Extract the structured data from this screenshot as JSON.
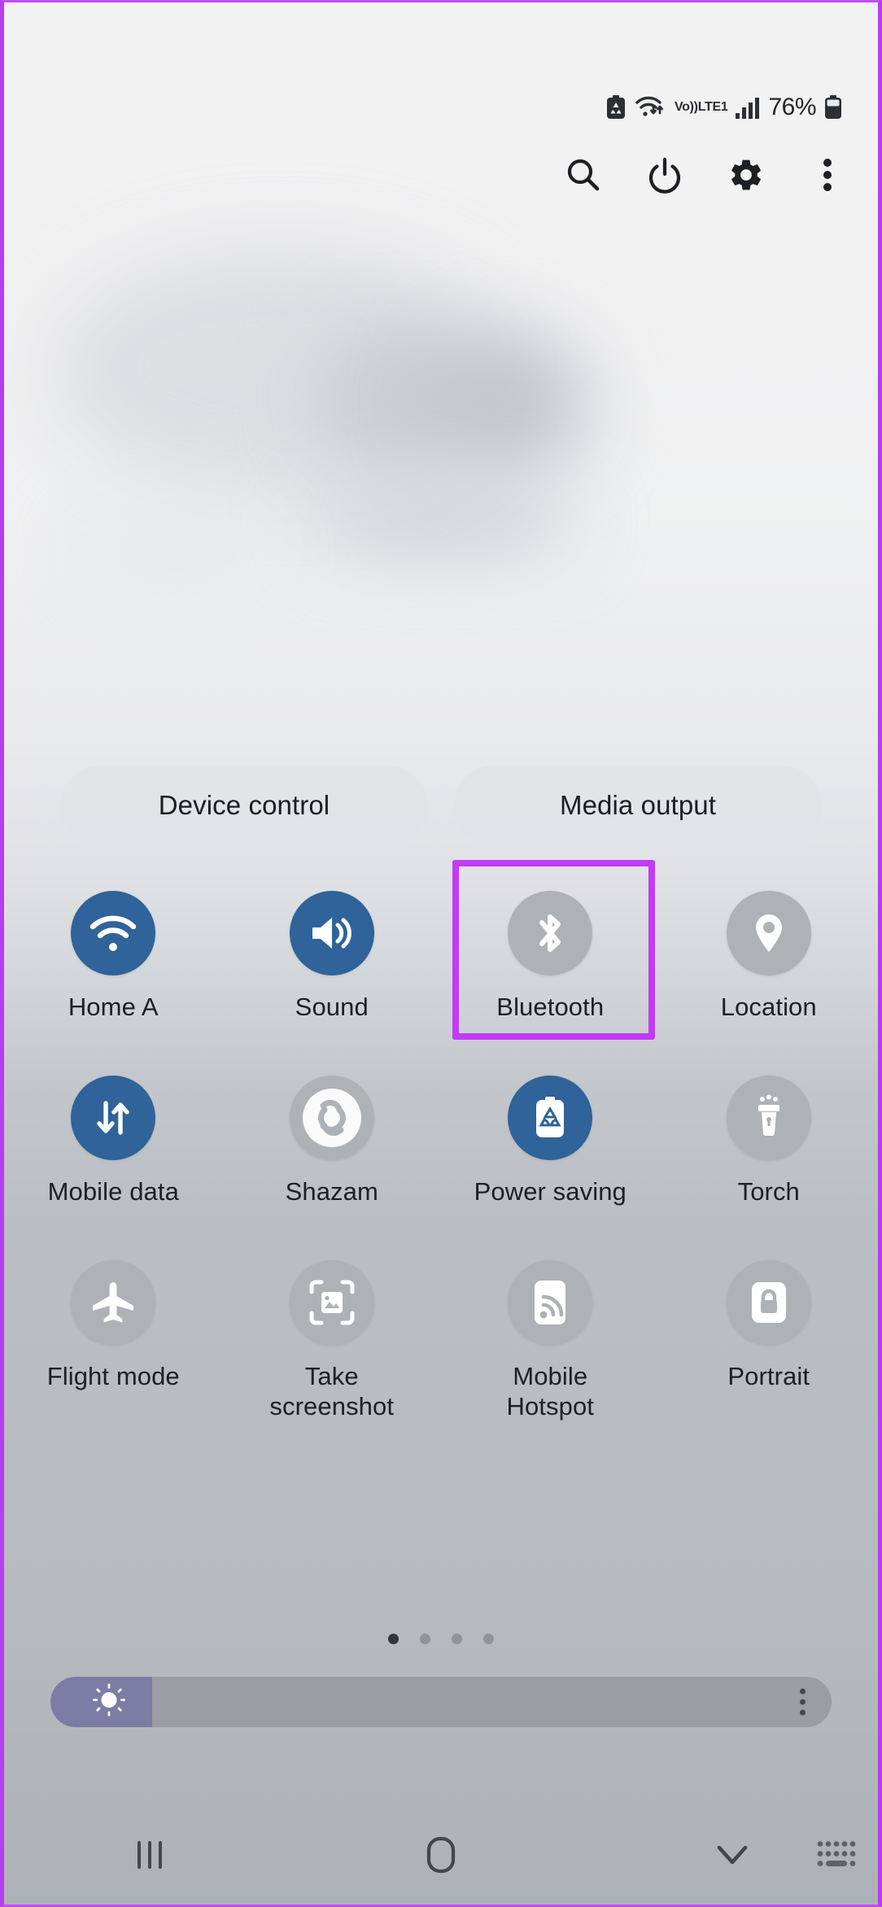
{
  "status_bar": {
    "battery_percent": "76%",
    "network_label": "Vo))",
    "network_sub": "LTE1",
    "icons": [
      "power-saving-battery-icon",
      "wifi-transfer-icon",
      "volte-icon",
      "signal-bars-icon",
      "battery-icon"
    ]
  },
  "header": {
    "actions": [
      {
        "name": "search-icon",
        "label": "Search"
      },
      {
        "name": "power-icon",
        "label": "Power"
      },
      {
        "name": "gear-icon",
        "label": "Settings"
      },
      {
        "name": "more-options-icon",
        "label": "More options"
      }
    ]
  },
  "shortcuts": {
    "device_control": "Device control",
    "media_output": "Media output"
  },
  "quick_settings": {
    "rows": [
      [
        {
          "label": "Home A",
          "icon": "wifi-icon",
          "state": "on"
        },
        {
          "label": "Sound",
          "icon": "volume-icon",
          "state": "on"
        },
        {
          "label": "Bluetooth",
          "icon": "bluetooth-icon",
          "state": "off",
          "highlighted": true
        },
        {
          "label": "Location",
          "icon": "location-pin-icon",
          "state": "off"
        }
      ],
      [
        {
          "label": "Mobile data",
          "icon": "mobile-data-icon",
          "state": "on"
        },
        {
          "label": "Shazam",
          "icon": "shazam-icon",
          "state": "off"
        },
        {
          "label": "Power saving",
          "icon": "power-saving-icon",
          "state": "on"
        },
        {
          "label": "Torch",
          "icon": "flashlight-icon",
          "state": "off"
        }
      ],
      [
        {
          "label": "Flight mode",
          "icon": "airplane-icon",
          "state": "off"
        },
        {
          "label": "Take screenshot",
          "icon": "screenshot-icon",
          "state": "off"
        },
        {
          "label": "Mobile Hotspot",
          "icon": "hotspot-icon",
          "state": "off"
        },
        {
          "label": "Portrait",
          "icon": "rotation-lock-icon",
          "state": "off"
        }
      ]
    ]
  },
  "pagination": {
    "total_pages": 4,
    "current_page": 1
  },
  "brightness": {
    "value_percent": 13,
    "icon": "brightness-sun-icon",
    "menu_icon": "more-options-icon"
  },
  "nav_bar": {
    "buttons": [
      {
        "name": "recents-button",
        "icon": "recents-icon"
      },
      {
        "name": "home-button",
        "icon": "home-icon"
      },
      {
        "name": "back-button",
        "icon": "chevron-down-icon"
      }
    ],
    "ime_switch": {
      "name": "keyboard-switch-button",
      "icon": "keyboard-icon"
    }
  },
  "colors": {
    "accent_active": "#2f6399",
    "tile_inactive": "#aeb2b7",
    "highlight": "#c23bf5",
    "slider_fill": "#7b7da4"
  }
}
